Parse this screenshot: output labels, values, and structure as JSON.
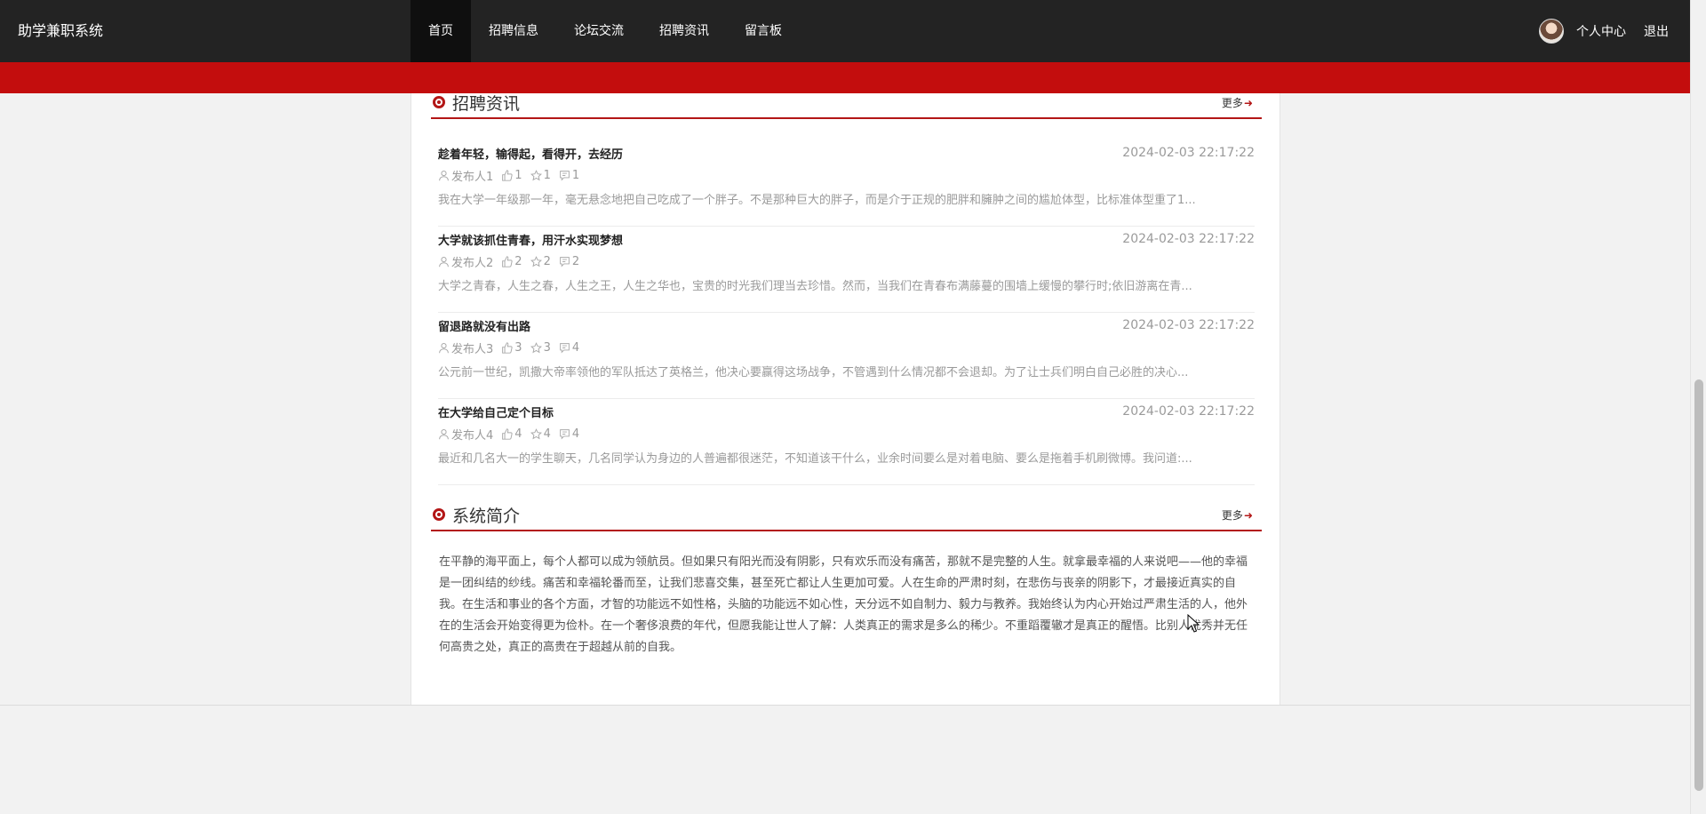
{
  "header": {
    "brand": "助学兼职系统",
    "nav": [
      {
        "label": "首页",
        "active": true
      },
      {
        "label": "招聘信息"
      },
      {
        "label": "论坛交流"
      },
      {
        "label": "招聘资讯"
      },
      {
        "label": "留言板"
      }
    ],
    "user_center": "个人中心",
    "logout": "退出"
  },
  "news_section": {
    "title": "招聘资讯",
    "more": "更多",
    "items": [
      {
        "title": "趁着年轻，输得起，看得开，去经历",
        "date": "2024-02-03 22:17:22",
        "author": "发布人1",
        "likes": "1",
        "favorites": "1",
        "comments": "1",
        "summary": "我在大学一年级那一年，毫无悬念地把自己吃成了一个胖子。不是那种巨大的胖子，而是介于正规的肥胖和臃肿之间的尴尬体型，比标准体型重了1..."
      },
      {
        "title": "大学就该抓住青春，用汗水实现梦想",
        "date": "2024-02-03 22:17:22",
        "author": "发布人2",
        "likes": "2",
        "favorites": "2",
        "comments": "2",
        "summary": "大学之青春，人生之春，人生之王，人生之华也，宝贵的时光我们理当去珍惜。然而，当我们在青春布满藤蔓的围墙上缓慢的攀行时;依旧游离在青..."
      },
      {
        "title": "留退路就没有出路",
        "date": "2024-02-03 22:17:22",
        "author": "发布人3",
        "likes": "3",
        "favorites": "3",
        "comments": "4",
        "summary": "公元前一世纪，凯撒大帝率领他的军队抵达了英格兰，他决心要赢得这场战争，不管遇到什么情况都不会退却。为了让士兵们明白自己必胜的决心..."
      },
      {
        "title": "在大学给自己定个目标",
        "date": "2024-02-03 22:17:22",
        "author": "发布人4",
        "likes": "4",
        "favorites": "4",
        "comments": "4",
        "summary": "最近和几名大一的学生聊天，几名同学认为身边的人普遍都很迷茫，不知道该干什么，业余时间要么是对着电脑、要么是拖着手机刷微博。我问道:..."
      }
    ]
  },
  "intro_section": {
    "title": "系统简介",
    "more": "更多",
    "text": "在平静的海平面上，每个人都可以成为领航员。但如果只有阳光而没有阴影，只有欢乐而没有痛苦，那就不是完整的人生。就拿最幸福的人来说吧——他的幸福是一团纠结的纱线。痛苦和幸福轮番而至，让我们悲喜交集，甚至死亡都让人生更加可爱。人在生命的严肃时刻，在悲伤与丧亲的阴影下，才最接近真实的自我。在生活和事业的各个方面，才智的功能远不如性格，头脑的功能远不如心性，天分远不如自制力、毅力与教养。我始终认为内心开始过严肃生活的人，他外在的生活会开始变得更为俭朴。在一个奢侈浪费的年代，但愿我能让世人了解：人类真正的需求是多么的稀少。不重蹈覆辙才是真正的醒悟。比别人优秀并无任何高贵之处，真正的高贵在于超越从前的自我。"
  },
  "colors": {
    "topbar": "#232323",
    "accent_red": "#c30d0d",
    "section_line": "#b31616"
  }
}
